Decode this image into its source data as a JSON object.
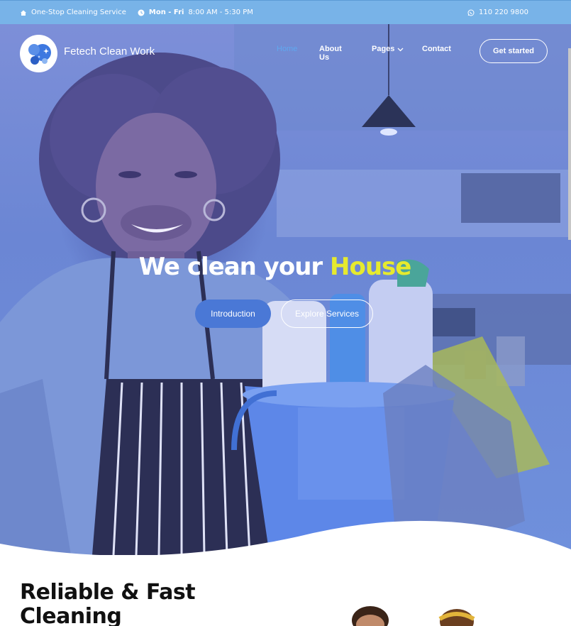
{
  "topbar": {
    "service": "One-Stop Cleaning Service",
    "days": "Mon - Fri",
    "hours": "8:00 AM - 5:30 PM",
    "phone": "110 220 9800",
    "icons": [
      "home-icon",
      "clock-icon",
      "whatsapp-icon"
    ]
  },
  "header": {
    "brand": "Fetech Clean Work",
    "nav": [
      {
        "label": "Home",
        "active": true
      },
      {
        "label": "About Us"
      },
      {
        "label": "Pages",
        "has_dropdown": true
      },
      {
        "label": "Contact"
      }
    ],
    "cta": "Get started"
  },
  "hero": {
    "headline_prefix": "We clean your ",
    "headline_accent": "House",
    "primary_button": "Introduction",
    "secondary_button": "Explore Services"
  },
  "section": {
    "title_line1": "Reliable & Fast",
    "title_line2": "Cleaning"
  },
  "colors": {
    "topbar": "#78b3e8",
    "hero_overlay": "#6b86d4",
    "accent_yellow": "#e6ea2e",
    "nav_active": "#5fa8f0",
    "primary_button": "#4a78d6"
  }
}
